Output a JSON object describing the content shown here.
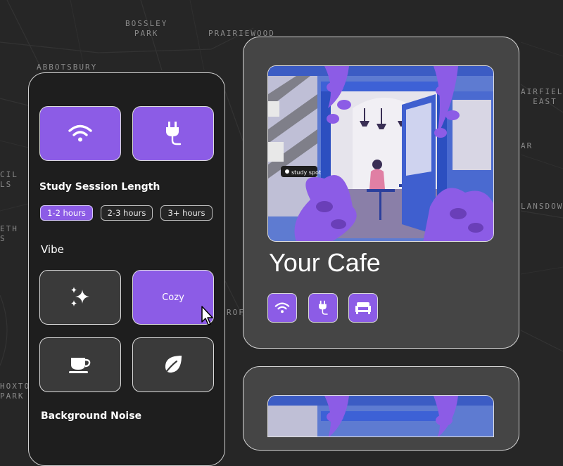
{
  "map": {
    "labels": [
      "BOSSLEY\nPARK",
      "PRAIRIEWOOD",
      "ABBOTSBURY",
      "AIRFIELD\nEAST",
      "AR",
      "CIL\nLS",
      "ETH\nS",
      "LANSDOW",
      "ROF",
      "HOXTO\nPARK"
    ]
  },
  "filters": {
    "amenity_tiles": [
      {
        "icon": "wifi-icon",
        "active": true
      },
      {
        "icon": "power-plug-icon",
        "active": true
      }
    ],
    "study_session_title": "Study Session Length",
    "session_options": [
      {
        "label": "1-2 hours",
        "active": true
      },
      {
        "label": "2-3 hours",
        "active": false
      },
      {
        "label": "3+ hours",
        "active": false
      }
    ],
    "vibe_title": "Vibe",
    "vibe_options": [
      {
        "icon": "sparkles-icon",
        "label": "",
        "active": false
      },
      {
        "icon": "",
        "label": "Cozy",
        "active": true
      },
      {
        "icon": "coffee-cup-icon",
        "label": "",
        "active": false
      },
      {
        "icon": "leaf-icon",
        "label": "",
        "active": false
      }
    ],
    "background_noise_title": "Background Noise"
  },
  "cafe": {
    "name": "Your Cafe",
    "sign_text": "study spot",
    "amenities": [
      "wifi-icon",
      "power-plug-icon",
      "armchair-icon"
    ]
  },
  "colors": {
    "accent": "#8c5ce6",
    "panel_bg": "#1e1e1e",
    "card_bg": "#454545",
    "map_bg": "#262626"
  }
}
